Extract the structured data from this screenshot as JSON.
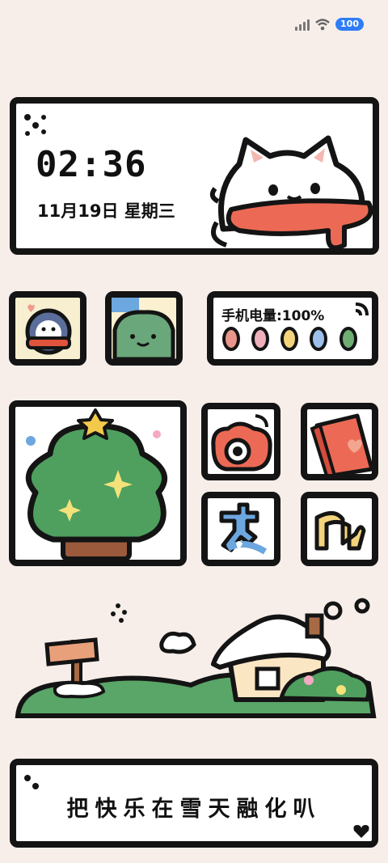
{
  "status_bar": {
    "signal_icon": "signal-bars-icon",
    "wifi_icon": "wifi-icon",
    "battery_level": "100"
  },
  "clock_widget": {
    "time": "02:36",
    "date": "11月19日 星期三"
  },
  "battery_widget": {
    "label": "手机电量:100%",
    "dot_colors": [
      "#e9958c",
      "#eeb0bb",
      "#f3d37c",
      "#9cc0ea",
      "#6fae72"
    ]
  },
  "app_icons": [
    {
      "name": "penguin-app-icon"
    },
    {
      "name": "frog-app-icon"
    },
    {
      "name": "camera-app-icon"
    },
    {
      "name": "book-app-icon"
    },
    {
      "name": "text-app-icon"
    },
    {
      "name": "music-app-icon"
    }
  ],
  "quote_widget": {
    "text": "把快乐在雪天融化叭"
  }
}
